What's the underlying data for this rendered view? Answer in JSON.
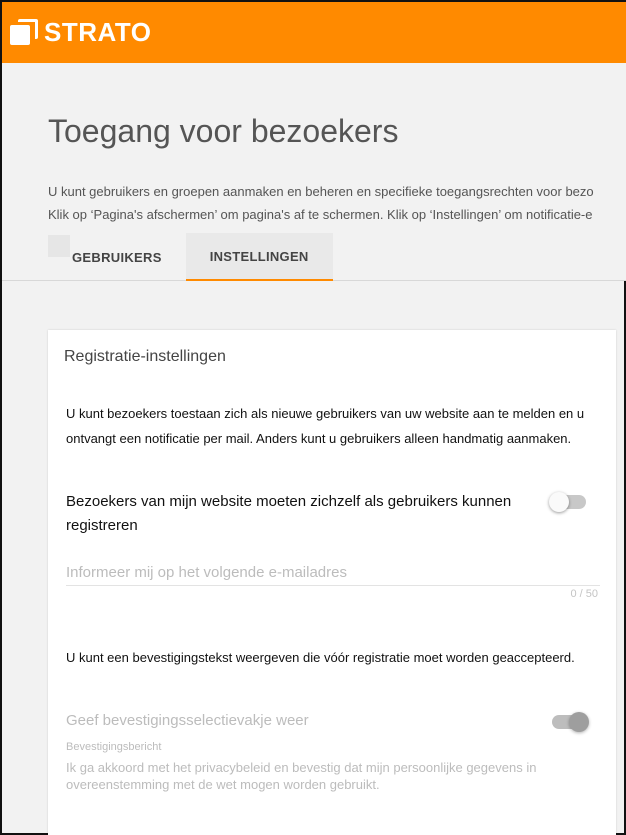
{
  "brand": {
    "logo_text": "STRATO",
    "color": "#ff8a00"
  },
  "page": {
    "title": "Toegang voor bezoekers",
    "intro_line1": "U kunt gebruikers en groepen aanmaken en beheren en specifieke toegangsrechten voor bezo",
    "intro_line2": "Klik op ‘Pagina's afschermen’ om pagina's af te schermen. Klik op ‘Instellingen’ om notificatie-e"
  },
  "tabs": [
    {
      "label": "GEBRUIKERS",
      "active": false
    },
    {
      "label": "INSTELLINGEN",
      "active": true
    }
  ],
  "card": {
    "title": "Registratie-instellingen",
    "description": "U kunt bezoekers toestaan zich als nieuwe gebruikers van uw website aan te melden en u ontvangt een notificatie per mail. Anders kunt u gebruikers alleen handmatig aanmaken.",
    "self_register_label": "Bezoekers van mijn website moeten zichzelf als gebruikers kunnen registreren",
    "self_register_on": false,
    "email_placeholder": "Informeer mij op het volgende e-mailadres",
    "email_value": "",
    "email_counter": "0 / 50",
    "confirm_description": "U kunt een bevestigingstekst weergeven die vóór registratie moet worden geaccepteerd.",
    "confirm_toggle_label": "Geef bevestigingsselectievakje weer",
    "confirm_toggle_on": true,
    "confirm_message_label": "Bevestigingsbericht",
    "confirm_message_text": "Ik ga akkoord met het privacybeleid en bevestig dat mijn persoonlijke gegevens in overeenstemming met de wet mogen worden gebruikt."
  }
}
